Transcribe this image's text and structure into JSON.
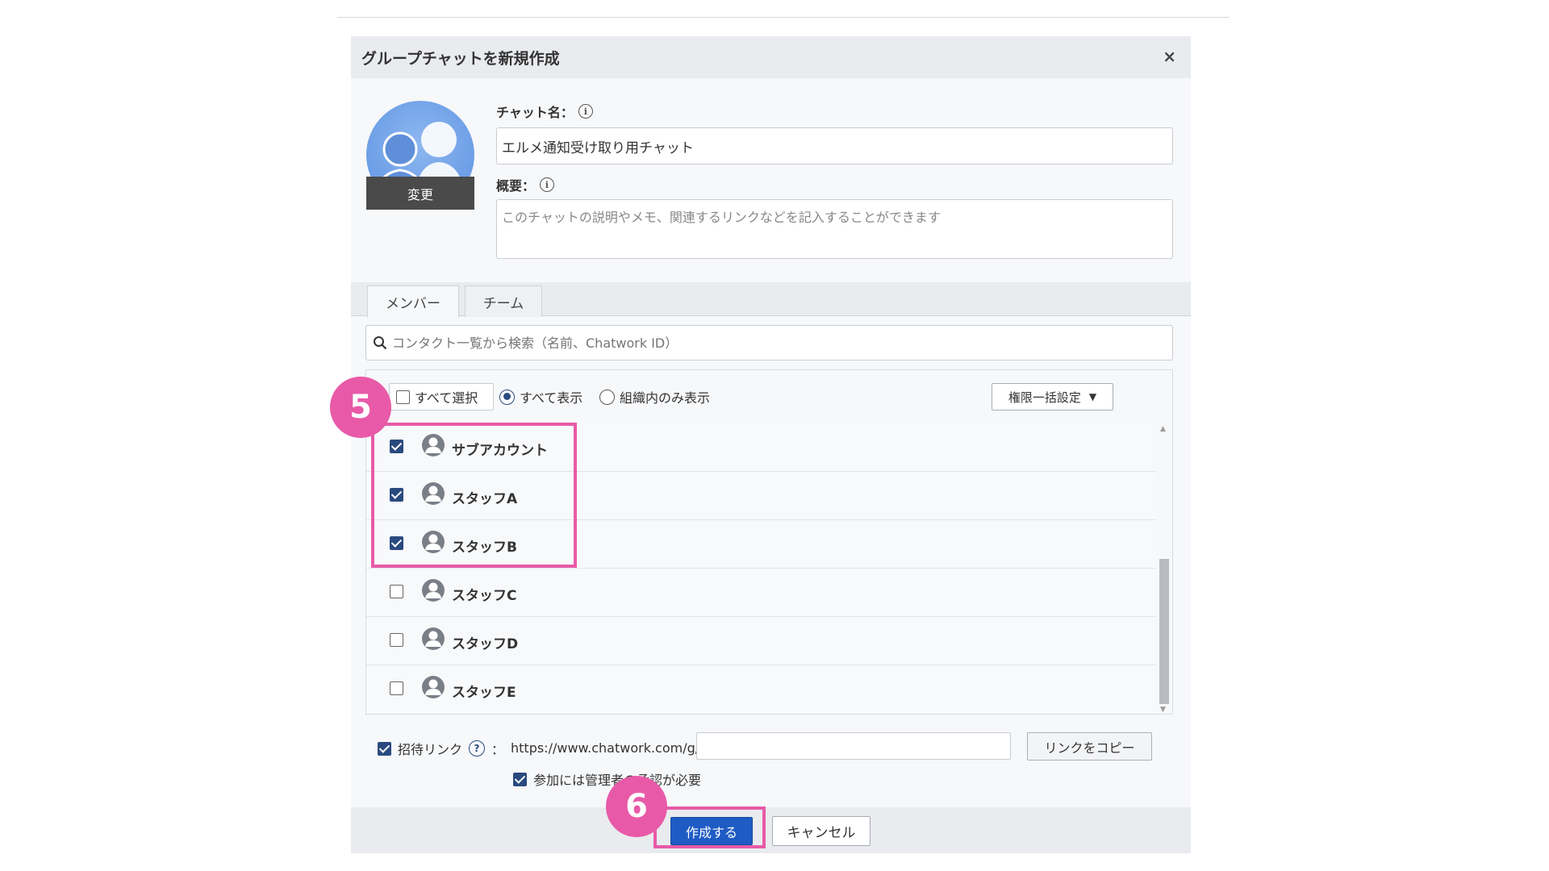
{
  "dialog": {
    "title": "グループチャットを新規作成",
    "close_label": "×",
    "avatar_change_label": "変更",
    "chat_name_label": "チャット名：",
    "chat_name_value": "エルメ通知受け取り用チャット",
    "description_label": "概要：",
    "description_placeholder": "このチャットの説明やメモ、関連するリンクなどを記入することができます",
    "info_glyph": "i"
  },
  "tabs": [
    {
      "label": "メンバー",
      "active": true
    },
    {
      "label": "チーム",
      "active": false
    }
  ],
  "search": {
    "placeholder": "コンタクト一覧から検索（名前、Chatwork ID）"
  },
  "filters": {
    "select_all_label": "すべて選択",
    "show_all_label": "すべて表示",
    "show_org_only_label": "組織内のみ表示",
    "bulk_permission_label": "権限一括設定",
    "bulk_permission_arrow": "▼"
  },
  "members": [
    {
      "name": "サブアカウント",
      "checked": true
    },
    {
      "name": "スタッフA",
      "checked": true
    },
    {
      "name": "スタッフB",
      "checked": true
    },
    {
      "name": "スタッフC",
      "checked": false
    },
    {
      "name": "スタッフD",
      "checked": false
    },
    {
      "name": "スタッフE",
      "checked": false
    }
  ],
  "invite": {
    "label": "招待リンク",
    "help_glyph": "?",
    "colon": "：",
    "url_prefix": "https://www.chatwork.com/g/",
    "url_value": "",
    "copy_label": "リンクをコピー",
    "approval_label": "参加には管理者の承認が必要",
    "invite_checked": true,
    "approval_checked": true
  },
  "footer": {
    "create_label": "作成する",
    "cancel_label": "キャンセル"
  },
  "annotations": {
    "step5": "5",
    "step6": "6",
    "highlight_color": "#e85aa8"
  },
  "colors": {
    "primary_button": "#1f5bc4",
    "checkbox_checked": "#2a4a7f",
    "avatar_blue": "#6b9de6"
  }
}
